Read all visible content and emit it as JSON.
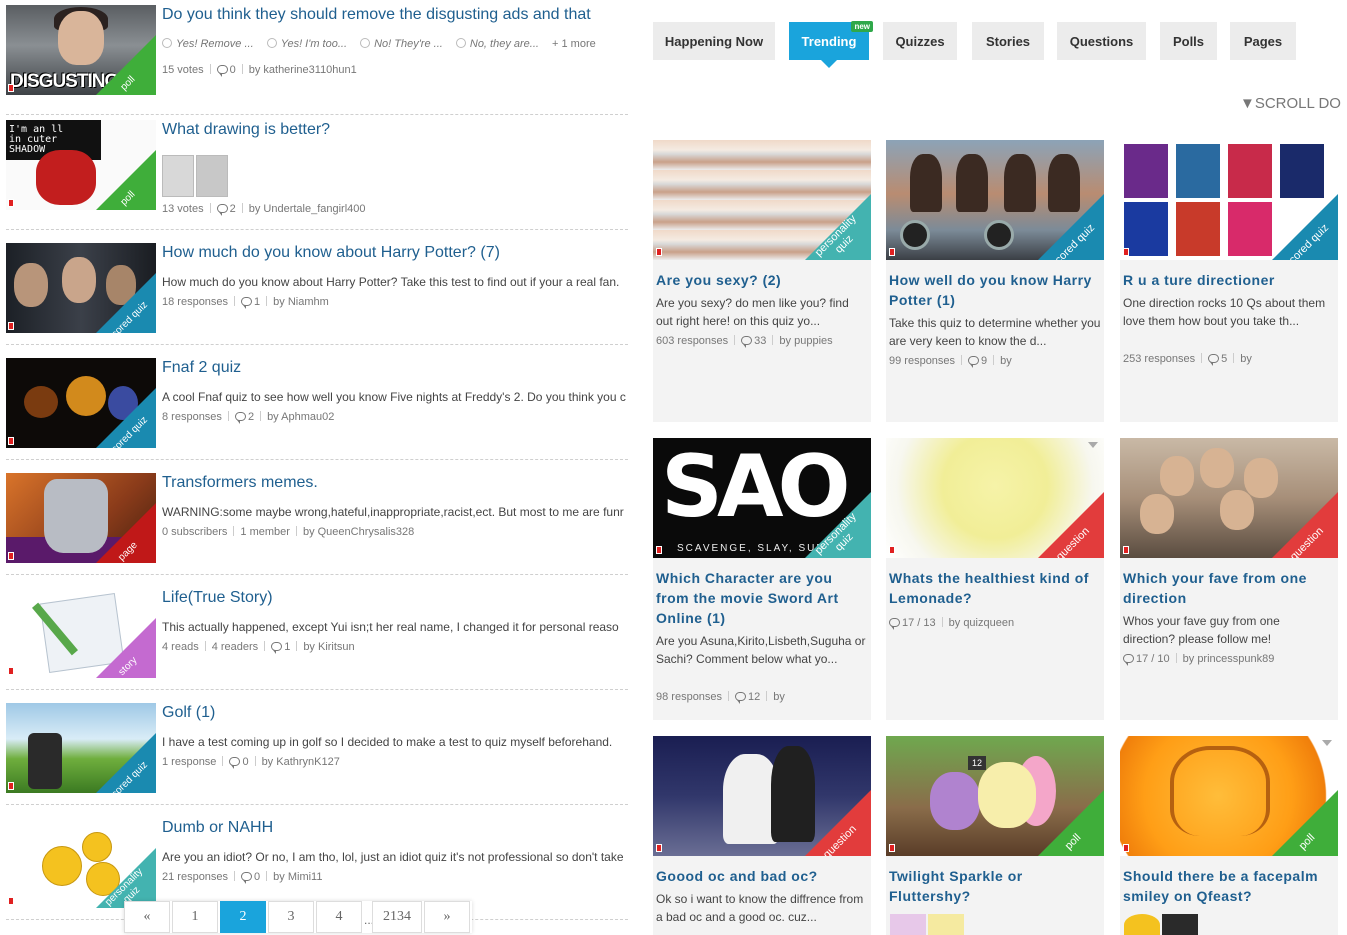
{
  "feed": {
    "items": [
      {
        "title": "Do you think they should remove the disgusting ads and that",
        "thumb_word": "DISGUSTING!",
        "badge": "poll",
        "poll_options": [
          "Yes! Remove ...",
          "Yes! I'm too...",
          "No! They're ...",
          "No, they are..."
        ],
        "more": "+ 1 more",
        "stat": "15 votes",
        "comments": "0",
        "author": "by katherine3110hun1"
      },
      {
        "title": "What drawing is better?",
        "thumb_text": "I'm an ll\nin cuter\nSHADOW",
        "badge": "poll",
        "stat": "13 votes",
        "comments": "2",
        "author": "by Undertale_fangirl400"
      },
      {
        "title": "How much do you know about Harry Potter? (7)",
        "badge": "scored quiz",
        "desc": "How much do you know about Harry Potter? Take this test to find out if your a real fan.",
        "stat": "18 responses",
        "comments": "1",
        "author": "by Niamhm"
      },
      {
        "title": "Fnaf 2 quiz",
        "badge": "scored quiz",
        "desc": "A cool Fnaf quiz to see how well you know Five nights at Freddy's 2. Do you think you c",
        "stat": "8 responses",
        "comments": "2",
        "author": "by Aphmau02"
      },
      {
        "title": "Transformers memes.",
        "badge": "page",
        "desc": "WARNING:some maybe wrong,hateful,inappropriate,racist,ect. But most to me are funr",
        "stat": "0 subscribers",
        "stat2": "1 member",
        "author": "by QueenChrysalis328"
      },
      {
        "title": "Life(True Story)",
        "badge": "story",
        "desc": "This actually happened, except Yui isn;t her real name, I changed it for personal reaso",
        "stat": "4 reads",
        "stat2": "4 readers",
        "comments": "1",
        "author": "by Kiritsun"
      },
      {
        "title": "Golf (1)",
        "badge": "scored quiz",
        "desc": "I have a test coming up in golf so I decided to make a test to quiz myself beforehand.",
        "stat": "1 response",
        "comments": "0",
        "author": "by KathrynK127"
      },
      {
        "title": "Dumb or NAHH",
        "badge": "personality quiz",
        "desc": "Are you an idiot? Or no, I am tho, lol, just an idiot quiz it's not professional so don't take",
        "stat": "21 responses",
        "comments": "0",
        "author": "by Mimi11"
      }
    ]
  },
  "pagination": {
    "prev": "«",
    "pages": [
      "1",
      "2",
      "3",
      "4"
    ],
    "ellipsis": "...",
    "last": "2134",
    "next": "»",
    "active": "2"
  },
  "tabs": [
    {
      "label": "Happening Now"
    },
    {
      "label": "Trending",
      "badge": "new"
    },
    {
      "label": "Quizzes"
    },
    {
      "label": "Stories"
    },
    {
      "label": "Questions"
    },
    {
      "label": "Polls"
    },
    {
      "label": "Pages"
    }
  ],
  "scroll_hint": "▼SCROLL DO",
  "cards": [
    {
      "title": "Are you sexy? (2)",
      "badge": "personality quiz",
      "desc": "Are you sexy? do men like you? find out right here! on this quiz yo...",
      "stat": "603 responses",
      "comments": "33",
      "author": "by puppies"
    },
    {
      "title": "How well do you know Harry Potter (1)",
      "badge": "scored quiz",
      "desc": "Take this quiz to determine whether you are very keen to know the d...",
      "stat": "99 responses",
      "comments": "9",
      "author": "by"
    },
    {
      "title": "R u a ture directioner",
      "badge": "scored quiz",
      "desc": "One direction rocks 10 Qs about them love them how bout you take th...",
      "stat": "253 responses",
      "comments": "5",
      "author": "by"
    },
    {
      "title": "Which Character are you from the movie Sword Art Online (1)",
      "badge": "personality quiz",
      "sao_big": "SAO",
      "sao_sub": "SCAVENGE, SLAY, SUR",
      "desc": "Are you Asuna,Kirito,Lisbeth,Suguha or Sachi? Comment below what yo...",
      "stat": "98 responses",
      "comments": "12",
      "author": "by"
    },
    {
      "title": "Whats the healthiest kind of Lemonade?",
      "badge": "question",
      "comments": "17 / 13",
      "author": "by quizqueen"
    },
    {
      "title": "Which your fave from one direction",
      "badge": "question",
      "desc": "Whos your fave guy from one direction? please follow me!",
      "comments": "17 / 10",
      "author": "by princesspunk89"
    },
    {
      "title": "Goood oc and bad oc?",
      "badge": "question",
      "desc": "Ok so i want to know the diffrence from a bad oc and a good oc. cuz..."
    },
    {
      "title": "Twilight Sparkle or Fluttershy?",
      "badge": "poll",
      "door_number": "12"
    },
    {
      "title": "Should there be a facepalm smiley on Qfeast?",
      "badge": "poll"
    }
  ],
  "colors": {
    "accent": "#1aa4dc",
    "title_blue": "#1f5f8f",
    "poll": "#3fae3a",
    "scored_quiz": "#1a8ab0",
    "personality_quiz": "#43b3b0",
    "page": "#c01818",
    "story": "#c46ad0",
    "question": "#e23c3c"
  }
}
